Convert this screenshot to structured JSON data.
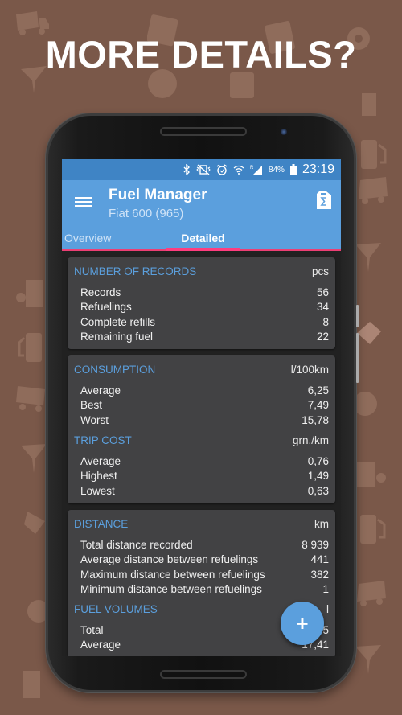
{
  "headline": "MORE DETAILS?",
  "status_bar": {
    "icons": [
      "bluetooth-icon",
      "vibrate-icon",
      "alarm-icon",
      "wifi-icon",
      "signal-icon",
      "battery-icon"
    ],
    "roaming_label": "R",
    "battery": "84%",
    "time": "23:19"
  },
  "app_bar": {
    "title": "Fuel Manager",
    "subtitle": "Fiat 600 (965)",
    "menu_icon": "menu-icon",
    "action_icon": "fuel-calculator-icon"
  },
  "tabs": [
    {
      "label": "Overview",
      "active": false
    },
    {
      "label": "Detailed",
      "active": true
    }
  ],
  "colors": {
    "accent": "#5b9fdd",
    "status_bar": "#3f84c5",
    "tab_indicator": "#ff3d7f",
    "background": "#7a5849",
    "card": "#424244"
  },
  "cards": [
    {
      "sections": [
        {
          "title": "NUMBER OF RECORDS",
          "unit": "pcs",
          "rows": [
            {
              "label": "Records",
              "value": "56"
            },
            {
              "label": "Refuelings",
              "value": "34"
            },
            {
              "label": "Complete refills",
              "value": "8"
            },
            {
              "label": "Remaining fuel",
              "value": "22"
            }
          ]
        }
      ]
    },
    {
      "sections": [
        {
          "title": "CONSUMPTION",
          "unit": "l/100km",
          "rows": [
            {
              "label": "Average",
              "value": "6,25"
            },
            {
              "label": "Best",
              "value": "7,49"
            },
            {
              "label": "Worst",
              "value": "15,78"
            }
          ]
        },
        {
          "title": "TRIP COST",
          "unit": "grn./km",
          "rows": [
            {
              "label": "Average",
              "value": "0,76"
            },
            {
              "label": "Highest",
              "value": "1,49"
            },
            {
              "label": "Lowest",
              "value": "0,63"
            }
          ]
        }
      ]
    },
    {
      "sections": [
        {
          "title": "DISTANCE",
          "unit": "km",
          "rows": [
            {
              "label": "Total distance recorded",
              "value": "8 939"
            },
            {
              "label": "Average distance between refuelings",
              "value": "441"
            },
            {
              "label": "Maximum distance between refuelings",
              "value": "382"
            },
            {
              "label": "Minimum distance between refuelings",
              "value": "1"
            }
          ]
        },
        {
          "title": "FUEL VOLUMES",
          "unit": "l",
          "rows": [
            {
              "label": "Total",
              "value": "4,95"
            },
            {
              "label": "Average",
              "value": "17,41"
            }
          ]
        }
      ]
    }
  ],
  "fab": {
    "label": "+",
    "icon": "add-icon"
  }
}
